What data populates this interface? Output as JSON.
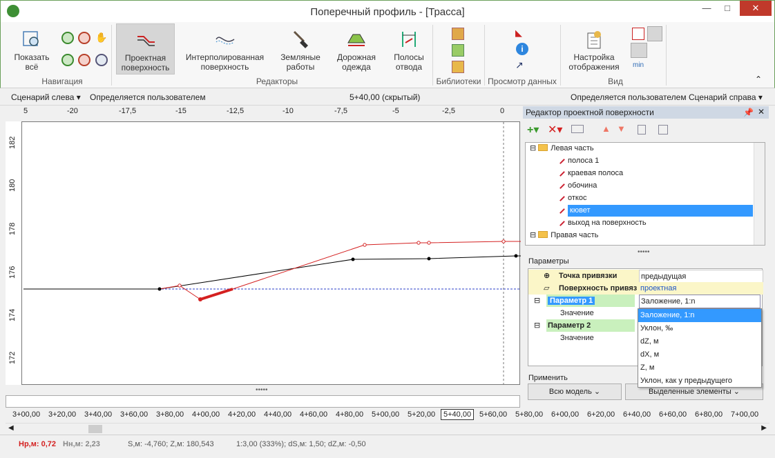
{
  "window": {
    "title": "Поперечный профиль - [Трасса]",
    "minimize": "—",
    "maximize": "□",
    "close": "✕"
  },
  "ribbon": {
    "buttons": {
      "show_all": "Показать всё",
      "design_surface": "Проектная поверхность",
      "interp_surface": "Интерполированная поверхность",
      "earthworks": "Земляные работы",
      "pavement": "Дорожная одежда",
      "row_bands": "Полосы отвода",
      "display_settings": "Настройка отображения",
      "min_label": "min"
    },
    "groups": {
      "navigation": "Навигация",
      "editors": "Редакторы",
      "libraries": "Библиотеки",
      "data_view": "Просмотр данных",
      "view": "Вид"
    }
  },
  "scenario": {
    "left_label": "Сценарий слева",
    "left_value": "Определяется пользователем",
    "center": "5+40,00 (скрытый)",
    "right_value": "Определяется пользователем",
    "right_label": "Сценарий справа"
  },
  "ruler": {
    "ticks": [
      "5",
      "-20",
      "-17,5",
      "-15",
      "-12,5",
      "-10",
      "-7,5",
      "-5",
      "-2,5",
      "0"
    ]
  },
  "yaxis": {
    "ticks": [
      "182",
      "180",
      "178",
      "176",
      "174",
      "172"
    ]
  },
  "panel": {
    "title": "Редактор проектной поверхности",
    "tree": {
      "left_part": "Левая часть",
      "items": [
        "полоса 1",
        "краевая полоса",
        "обочина",
        "откос",
        "кювет",
        "выход на поверхность"
      ],
      "right_part": "Правая часть"
    },
    "params_title": "Параметры",
    "params": {
      "anchor_point_label": "Точка привязки",
      "anchor_point_value": "предыдущая",
      "anchor_surface_label": "Поверхность привязки",
      "anchor_surface_value": "проектная",
      "param1_label": "Параметр 1",
      "param1_value": "Заложение, 1:n",
      "value_label": "Значение",
      "param2_label": "Параметр 2"
    },
    "dropdown_options": [
      "Заложение, 1:n",
      "Уклон, ‰",
      "dZ, м",
      "dX, м",
      "Z, м",
      "Уклон, как у предыдущего"
    ],
    "apply_title": "Применить",
    "apply_all": "Всю модель",
    "apply_selected": "Выделенные элементы"
  },
  "stations": [
    "3+00,00",
    "3+20,00",
    "3+40,00",
    "3+60,00",
    "3+80,00",
    "4+00,00",
    "4+20,00",
    "4+40,00",
    "4+60,00",
    "4+80,00",
    "5+00,00",
    "5+20,00",
    "5+40,00",
    "5+60,00",
    "5+80,00",
    "6+00,00",
    "6+20,00",
    "6+40,00",
    "6+60,00",
    "6+80,00",
    "7+00,00"
  ],
  "selected_station": "5+40,00",
  "status": {
    "hr": "Нр,м: 0,72",
    "hn": "Нн,м: 2,23",
    "sz": "S,м: -4,760;  Z,м: 180,543",
    "scale": "1:3,00 (333%);  dS,м: 1,50;  dZ,м: -0,50"
  },
  "colors": {
    "design_line": "#d42020",
    "ground_line": "#000000",
    "dash_line": "#2a3cc8"
  }
}
